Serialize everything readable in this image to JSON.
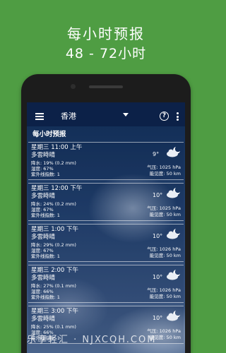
{
  "promo": {
    "title": "每小时预报",
    "subtitle": "48 - 72小时"
  },
  "app_bar": {
    "location": "香港",
    "help_label": "?"
  },
  "section_title": "每小时预报",
  "forecasts": [
    {
      "time": "星期三 11:00 上午",
      "condition": "多雲時晴",
      "precip": "降水: 19% (0.2 mm)",
      "humidity": "湿度: 67%",
      "uv": "紫外线指数: 1",
      "temp": "9°",
      "pressure": "气压: 1025 hPa",
      "visibility": "能见度: 50 km",
      "icon": "partly-cloudy-moon-icon"
    },
    {
      "time": "星期三 12:00 下午",
      "condition": "多雲時晴",
      "precip": "降水: 24% (0.2 mm)",
      "humidity": "湿度: 67%",
      "uv": "紫外线指数: 1",
      "temp": "10°",
      "pressure": "气压: 1025 hPa",
      "visibility": "能见度: 50 km",
      "icon": "partly-cloudy-moon-icon"
    },
    {
      "time": "星期三 1:00 下午",
      "condition": "多雲時晴",
      "precip": "降水: 29% (0.2 mm)",
      "humidity": "湿度: 67%",
      "uv": "紫外线指数: 1",
      "temp": "10°",
      "pressure": "气压: 1026 hPa",
      "visibility": "能见度: 50 km",
      "icon": "partly-cloudy-moon-icon"
    },
    {
      "time": "星期三 2:00 下午",
      "condition": "多雲時晴",
      "precip": "降水: 27% (0.1 mm)",
      "humidity": "湿度: 66%",
      "uv": "紫外线指数: 1",
      "temp": "10°",
      "pressure": "气压: 1026 hPa",
      "visibility": "能见度: 50 km",
      "icon": "partly-cloudy-moon-icon"
    },
    {
      "time": "星期三 3:00 下午",
      "condition": "多雲時晴",
      "precip": "降水: 25% (0.1 mm)",
      "humidity": "湿度: 66%",
      "uv": "紫外线指数: 1",
      "temp": "10°",
      "pressure": "气压: 1026 hPa",
      "visibility": "能见度: 50 km",
      "icon": "partly-cloudy-moon-icon"
    }
  ],
  "nav": [
    "home-icon",
    "chart-icon",
    "radar-icon",
    "bars-icon",
    "moon-icon"
  ],
  "watermark": "乐享轻汇 · NJXCQH.COM",
  "colors": {
    "background": "#4f9d43",
    "app_bar": "#0c2148",
    "sky_top": "#0f2a52"
  }
}
